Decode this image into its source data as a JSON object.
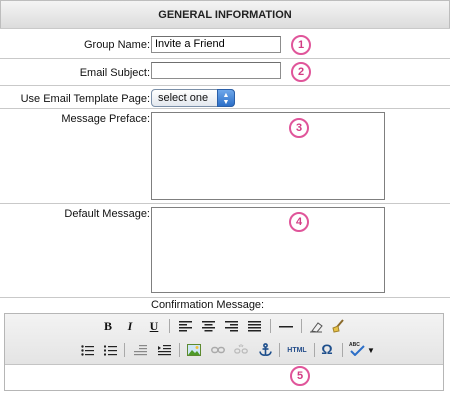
{
  "header": {
    "title": "GENERAL INFORMATION"
  },
  "fields": {
    "group_name": {
      "label": "Group Name:",
      "value": "Invite a Friend",
      "badge": "1"
    },
    "email_subject": {
      "label": "Email Subject:",
      "value": "",
      "badge": "2"
    },
    "template_page": {
      "label": "Use Email Template Page:",
      "selected": "select one"
    },
    "message_preface": {
      "label": "Message Preface:",
      "badge": "3"
    },
    "default_message": {
      "label": "Default Message:",
      "badge": "4"
    },
    "confirmation_message": {
      "label": "Confirmation Message:",
      "badge": "5"
    }
  },
  "toolbar": {
    "bold": "B",
    "italic": "I",
    "underline": "U",
    "html": "HTML",
    "omega": "Ω"
  },
  "colors": {
    "badge": "#e0559a",
    "select_accent": "#2c6fc8"
  }
}
